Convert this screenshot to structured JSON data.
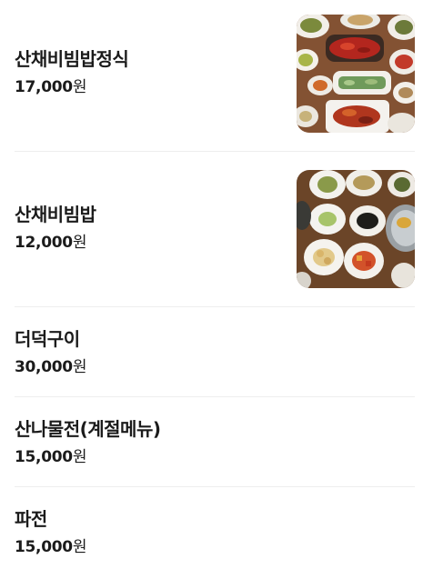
{
  "menu": {
    "items": [
      {
        "name": "산채비빔밥정식",
        "price": "17,000",
        "currency": "원",
        "photo": "korean-table-set-photo"
      },
      {
        "name": "산채비빔밥",
        "price": "12,000",
        "currency": "원",
        "photo": "bibimbap-side-dishes-photo"
      },
      {
        "name": "더덕구이",
        "price": "30,000",
        "currency": "원"
      },
      {
        "name": "산나물전(계절메뉴)",
        "price": "15,000",
        "currency": "원"
      },
      {
        "name": "파전",
        "price": "15,000",
        "currency": "원"
      }
    ]
  }
}
